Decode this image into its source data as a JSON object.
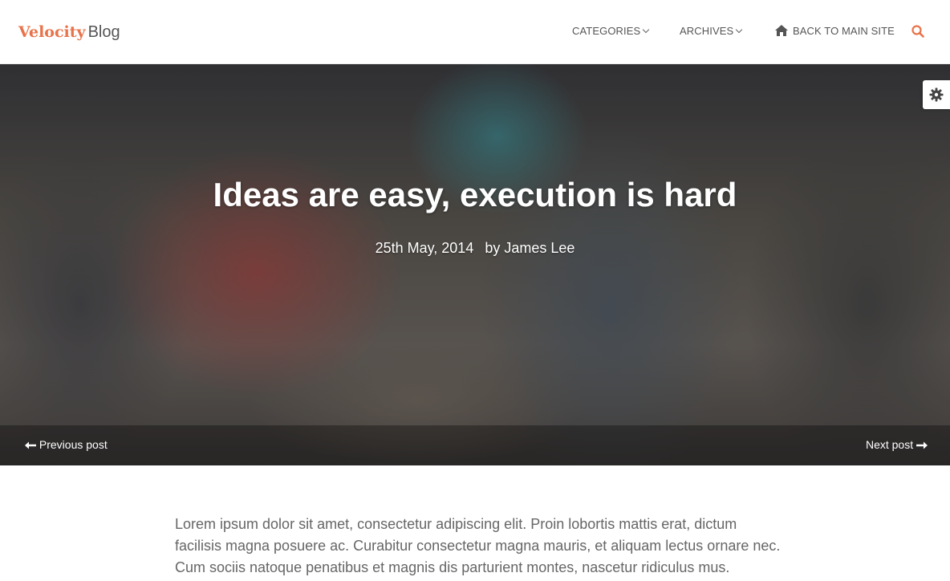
{
  "brand": {
    "primary": "Velocity",
    "secondary": "Blog"
  },
  "nav": {
    "categories": "CATEGORIES",
    "archives": "ARCHIVES",
    "back": "BACK TO MAIN SITE"
  },
  "icons": {
    "search": "search-icon",
    "home": "home-icon",
    "settings": "gear-icon",
    "prev": "arrow-left-icon",
    "next": "arrow-right-icon",
    "dropdown": "chevron-down-icon"
  },
  "hero": {
    "title": "Ideas are easy, execution is hard",
    "date": "25th May, 2014",
    "author_prefix": "by",
    "author": "James Lee"
  },
  "post_nav": {
    "previous": "Previous post",
    "next": "Next post"
  },
  "article": {
    "paragraph": "Lorem ipsum dolor sit amet, consectetur adipiscing elit. Proin lobortis mattis erat, dictum facilisis magna posuere ac. Curabitur consectetur magna mauris, et aliquam lectus ornare nec. Cum sociis natoque penatibus et magnis dis parturient montes, nascetur ridiculus mus."
  },
  "colors": {
    "brand_accent": "#e8734a",
    "text": "#555555",
    "hero_text": "#ffffff"
  }
}
